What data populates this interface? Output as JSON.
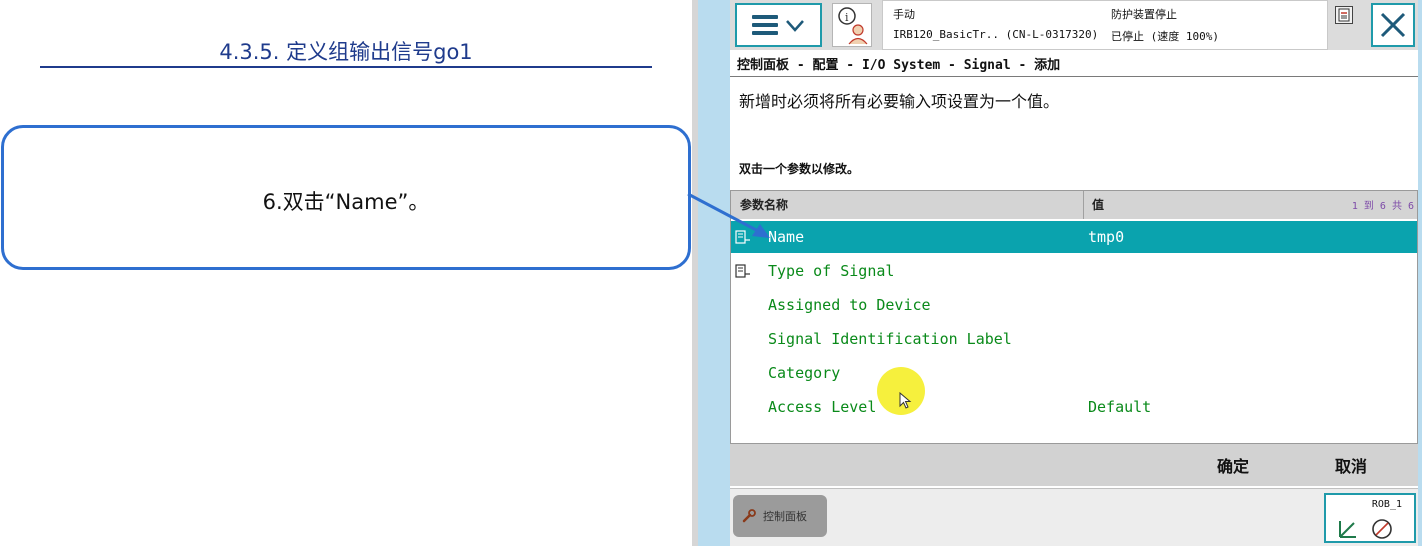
{
  "slide": {
    "title": "4.3.5. 定义组输出信号go1",
    "instruction": "6.双击“Name”。"
  },
  "pendant": {
    "status": {
      "mode": "手动",
      "robot": "IRB120_BasicTr.. (CN-L-0317320)",
      "guard": "防护装置停止",
      "state": "已停止 (速度 100%)"
    },
    "breadcrumb": "控制面板 - 配置 - I/O System - Signal - 添加",
    "instruction": "新增时必须将所有必要输入项设置为一个值。",
    "sub_instruction": "双击一个参数以修改。",
    "table": {
      "header_name": "参数名称",
      "header_value": "值",
      "count": "1 到 6 共 6",
      "rows": [
        {
          "label": "Name",
          "value": "tmp0",
          "selected": true
        },
        {
          "label": "Type of Signal",
          "value": ""
        },
        {
          "label": "Assigned to Device",
          "value": ""
        },
        {
          "label": "Signal Identification Label",
          "value": ""
        },
        {
          "label": "Category",
          "value": ""
        },
        {
          "label": "Access Level",
          "value": "Default"
        }
      ]
    },
    "buttons": {
      "ok": "确定",
      "cancel": "取消"
    },
    "taskbar": {
      "control_panel": "控制面板",
      "robot": "ROB_1"
    },
    "colors": {
      "accent": "#0aa3ae",
      "label_green": "#0a8a1a",
      "slide_blue": "#1f3b8c"
    }
  }
}
